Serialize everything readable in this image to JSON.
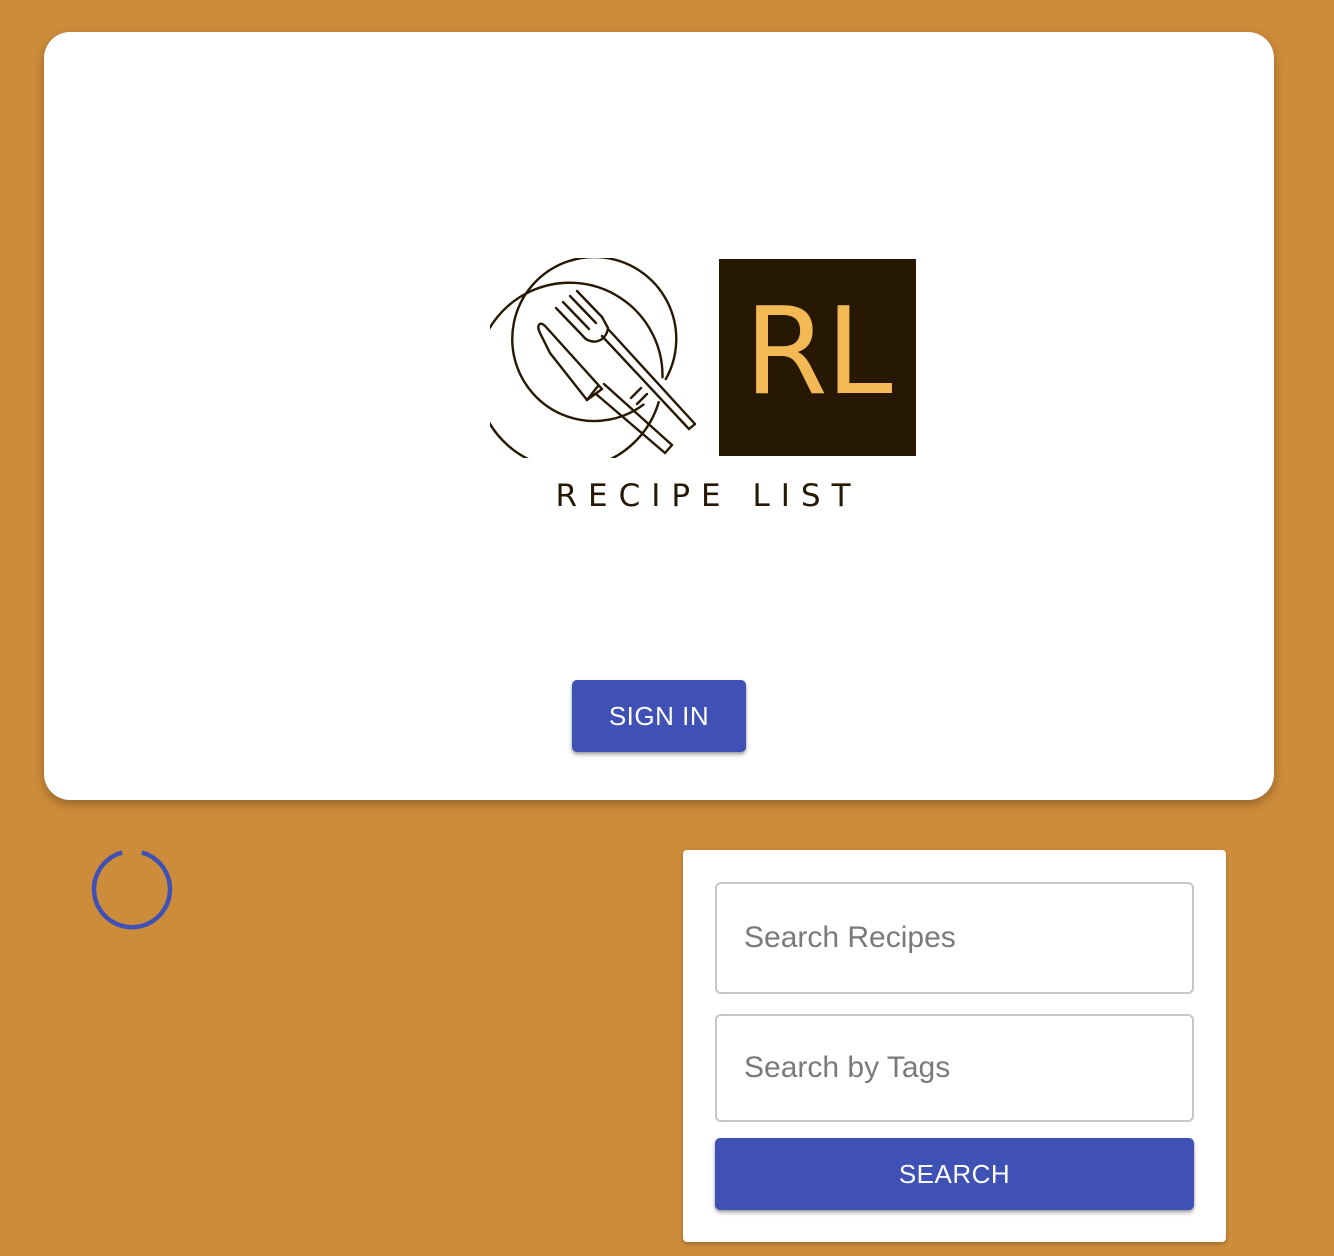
{
  "colors": {
    "page_background": "#CD8C3A",
    "card_background": "#FFFFFF",
    "primary_button": "#3F51B5",
    "logo_dark": "#271803",
    "logo_accent": "#F2B954",
    "spinner": "#3F51B5"
  },
  "hero": {
    "logo": {
      "emblem_icon": "plate-fork-knife-icon",
      "monogram": "RL",
      "wordmark": "RECIPE LIST"
    },
    "sign_in_label": "SIGN IN"
  },
  "loading": {
    "indicator": "circular-spinner-icon"
  },
  "search": {
    "recipes_placeholder": "Search Recipes",
    "recipes_value": "",
    "tags_placeholder": "Search by Tags",
    "tags_value": "",
    "button_label": "SEARCH"
  }
}
